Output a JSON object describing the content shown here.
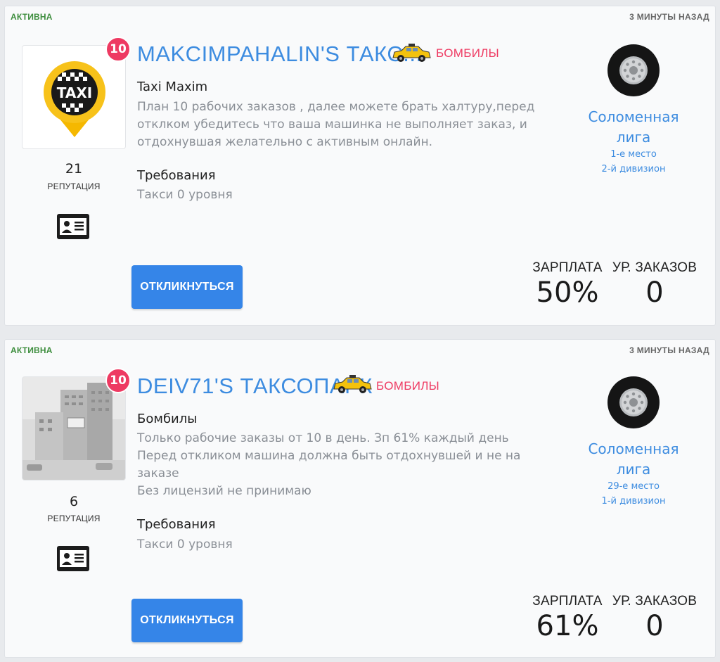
{
  "listings": [
    {
      "status": "АКТИВНА",
      "time_ago": "3 МИНУТЫ НАЗАД",
      "badge_level": "10",
      "title": "MAKCIMPAHALIN'S ТАКС...",
      "tag": "БОМБИЛЫ",
      "logo_icon": "taxi-maxim-logo",
      "logo_text": "TAXI",
      "subtitle": "Taxi Maxim",
      "description": [
        "План 10 рабочих заказов , далее можете брать халтуру,перед",
        "отклком убедитесь что ваша машинка не выполняет заказ, и",
        "отдохнувшая желательно с активным онлайн."
      ],
      "reputation": "21",
      "reputation_label": "РЕПУТАЦИЯ",
      "requirements_label": "Требования",
      "requirements_value": "Такси 0 уровня",
      "button_label": "ОТКЛИКНУТЬСЯ",
      "league_name": "Соломенная лига",
      "league_name_lines": [
        "Соломенная",
        "лига"
      ],
      "league_place": "1-е место",
      "league_division": "2-й дивизион",
      "salary_label": "ЗАРПЛАТА",
      "salary_value": "50%",
      "orders_label": "УР. ЗАКАЗОВ",
      "orders_value": "0"
    },
    {
      "status": "АКТИВНА",
      "time_ago": "3 МИНУТЫ НАЗАД",
      "badge_level": "10",
      "title": "DEIV71'S ТАКСОПАРК",
      "tag": "БОМБИЛЫ",
      "logo_icon": "building-photo",
      "subtitle": "Бомбилы",
      "description": [
        "Только рабочие заказы от 10 в день. Зп 61% каждый день",
        "Перед откликом машина должна быть отдохнувшей и не на",
        "заказе",
        "Без лицензий не принимаю"
      ],
      "reputation": "6",
      "reputation_label": "РЕПУТАЦИЯ",
      "requirements_label": "Требования",
      "requirements_value": "Такси 0 уровня",
      "button_label": "ОТКЛИКНУТЬСЯ",
      "league_name": "Соломенная лига",
      "league_name_lines": [
        "Соломенная",
        "лига"
      ],
      "league_place": "29-е место",
      "league_division": "1-й дивизион",
      "salary_label": "ЗАРПЛАТА",
      "salary_value": "61%",
      "orders_label": "УР. ЗАКАЗОВ",
      "orders_value": "0"
    }
  ],
  "colors": {
    "accent_blue": "#3d8ce0",
    "button_blue": "#3585e8",
    "tag_pink": "#ee3a62",
    "status_green": "#3e8e3e",
    "muted_text": "#8a8f96"
  }
}
